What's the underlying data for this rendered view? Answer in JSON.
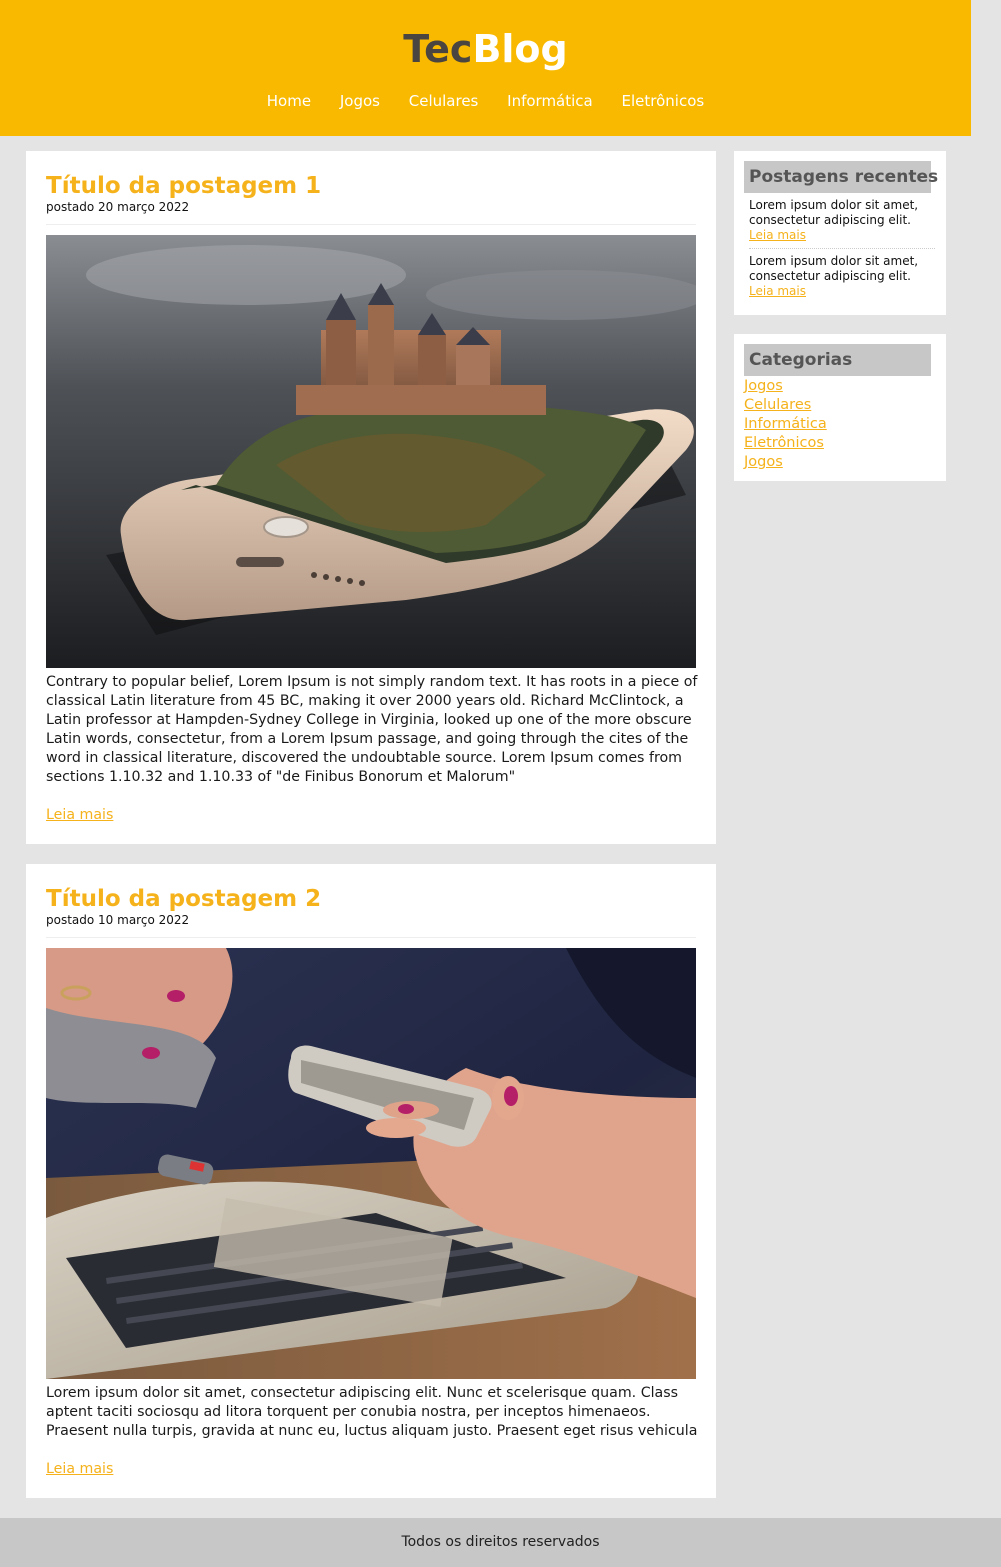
{
  "header": {
    "logo_part1": "Tec",
    "logo_part2": "Blog",
    "nav": [
      "Home",
      "Jogos",
      "Celulares",
      "Informática",
      "Eletrônicos"
    ]
  },
  "posts": [
    {
      "title": "Título da postagem 1",
      "date": "postado 20 março 2022",
      "image": "smartphone-castle-photo",
      "text": "Contrary to popular belief, Lorem Ipsum is not simply random text. It has roots in a piece of classical Latin literature from 45 BC, making it over 2000 years old. Richard McClintock, a Latin professor at Hampden-Sydney College in Virginia, looked up one of the more obscure Latin words, consectetur, from a Lorem Ipsum passage, and going through the cites of the word in classical literature, discovered the undoubtable source. Lorem Ipsum comes from sections 1.10.32 and 1.10.33 of \"de Finibus Bonorum et Malorum\"",
      "read_more": "Leia mais"
    },
    {
      "title": "Título da postagem 2",
      "date": "postado 10 março 2022",
      "image": "hands-phone-laptop-photo",
      "text": "Lorem ipsum dolor sit amet, consectetur adipiscing elit. Nunc et scelerisque quam. Class aptent taciti sociosqu ad litora torquent per conubia nostra, per inceptos himenaeos. Praesent nulla turpis, gravida at nunc eu, luctus aliquam justo. Praesent eget risus vehicula",
      "read_more": "Leia mais"
    }
  ],
  "sidebar": {
    "recent": {
      "title": "Postagens recentes",
      "items": [
        {
          "text": "Lorem ipsum dolor sit amet, consectetur adipiscing elit.",
          "link": "Leia mais"
        },
        {
          "text": "Lorem ipsum dolor sit amet, consectetur adipiscing elit.",
          "link": "Leia mais"
        }
      ]
    },
    "categories": {
      "title": "Categorias",
      "items": [
        "Jogos",
        "Celulares",
        "Informática",
        "Eletrônicos",
        "Jogos"
      ]
    }
  },
  "footer": {
    "text": "Todos os direitos reservados"
  },
  "colors": {
    "brand": "#f8b900",
    "accent": "#f5b21b",
    "background": "#e4e4e4",
    "widget_title_bg": "#c7c7c7"
  }
}
